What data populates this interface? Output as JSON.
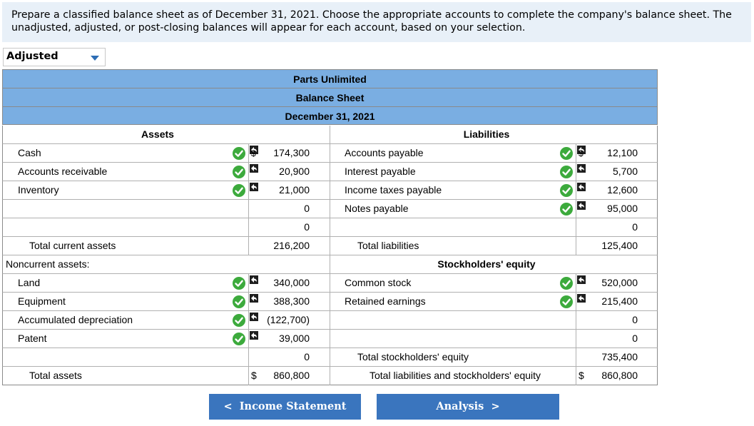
{
  "instructions": "Prepare a classified balance sheet as of December 31, 2021. Choose the appropriate accounts to complete the company's balance sheet. The unadjusted, adjusted, or post-closing balances will appear for each account, based on your selection.",
  "balance_selector": {
    "value": "Adjusted"
  },
  "header": {
    "company": "Parts Unlimited",
    "statement": "Balance Sheet",
    "date": "December 31, 2021"
  },
  "assets": {
    "title": "Assets",
    "current": [
      {
        "label": "Cash",
        "amount": "174,300",
        "dollar": "$"
      },
      {
        "label": "Accounts receivable",
        "amount": "20,900"
      },
      {
        "label": "Inventory",
        "amount": "21,000"
      },
      {
        "label": "",
        "amount": "0"
      },
      {
        "label": "",
        "amount": "0"
      }
    ],
    "total_current_label": "Total current assets",
    "total_current_amount": "216,200",
    "noncurrent_label": "Noncurrent assets:",
    "noncurrent": [
      {
        "label": "Land",
        "amount": "340,000"
      },
      {
        "label": "Equipment",
        "amount": "388,300"
      },
      {
        "label": "Accumulated depreciation",
        "amount": "(122,700)"
      },
      {
        "label": "Patent",
        "amount": "39,000"
      },
      {
        "label": "",
        "amount": "0"
      }
    ],
    "total_label": "Total assets",
    "total_dollar": "$",
    "total_amount": "860,800"
  },
  "liabilities": {
    "title": "Liabilities",
    "items": [
      {
        "label": "Accounts payable",
        "amount": "12,100",
        "dollar": "$"
      },
      {
        "label": "Interest payable",
        "amount": "5,700"
      },
      {
        "label": "Income taxes payable",
        "amount": "12,600"
      },
      {
        "label": "Notes payable",
        "amount": "95,000"
      },
      {
        "label": "",
        "amount": "0"
      }
    ],
    "total_label": "Total liabilities",
    "total_amount": "125,400"
  },
  "equity": {
    "title": "Stockholders' equity",
    "items": [
      {
        "label": "Common stock",
        "amount": "520,000"
      },
      {
        "label": "Retained earnings",
        "amount": "215,400"
      },
      {
        "label": "",
        "amount": "0"
      },
      {
        "label": "",
        "amount": "0"
      }
    ],
    "total_label": "Total stockholders' equity",
    "total_amount": "735,400",
    "grand_total_label": "Total liabilities and stockholders' equity",
    "grand_total_dollar": "$",
    "grand_total_amount": "860,800"
  },
  "nav": {
    "prev_label": "Income Statement",
    "next_label": "Analysis"
  },
  "colors": {
    "header_fill": "#7aaee2",
    "instructions_bg": "#e8f0f8",
    "button": "#3a75be",
    "check": "#3caa3c"
  }
}
